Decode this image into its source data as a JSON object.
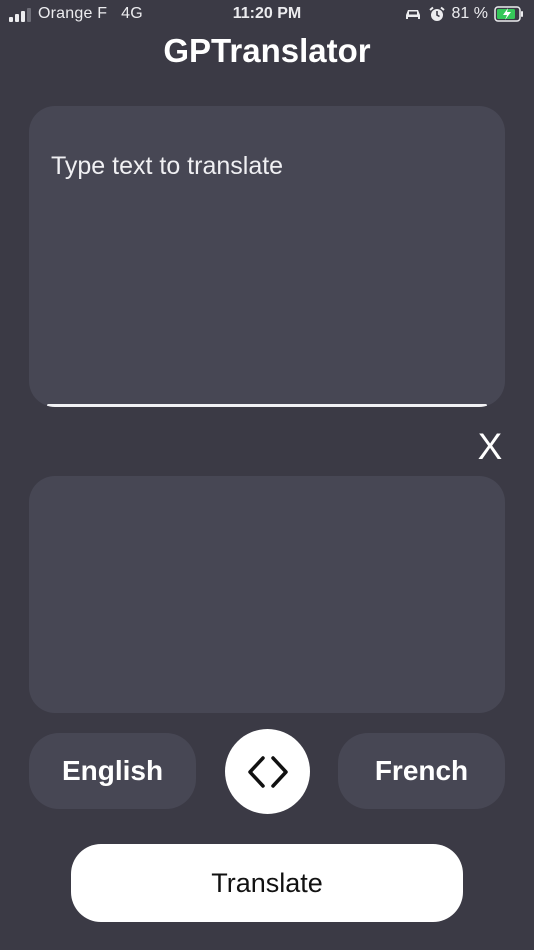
{
  "status_bar": {
    "carrier": "Orange F",
    "network": "4G",
    "time": "11:20 PM",
    "battery_percent": "81 %",
    "icons": [
      "signal-icon",
      "car-icon",
      "alarm-icon",
      "battery-charging-icon"
    ]
  },
  "app": {
    "title": "GPTranslator"
  },
  "input": {
    "placeholder": "Type text to translate"
  },
  "clear_label": "X",
  "output": {
    "text": ""
  },
  "languages": {
    "source": "English",
    "target": "French"
  },
  "swap_icon": "swap-arrows-icon",
  "translate_label": "Translate",
  "colors": {
    "background": "#3b3a45",
    "panel": "#474754",
    "button_light": "#ffffff",
    "battery_green": "#35c759"
  }
}
